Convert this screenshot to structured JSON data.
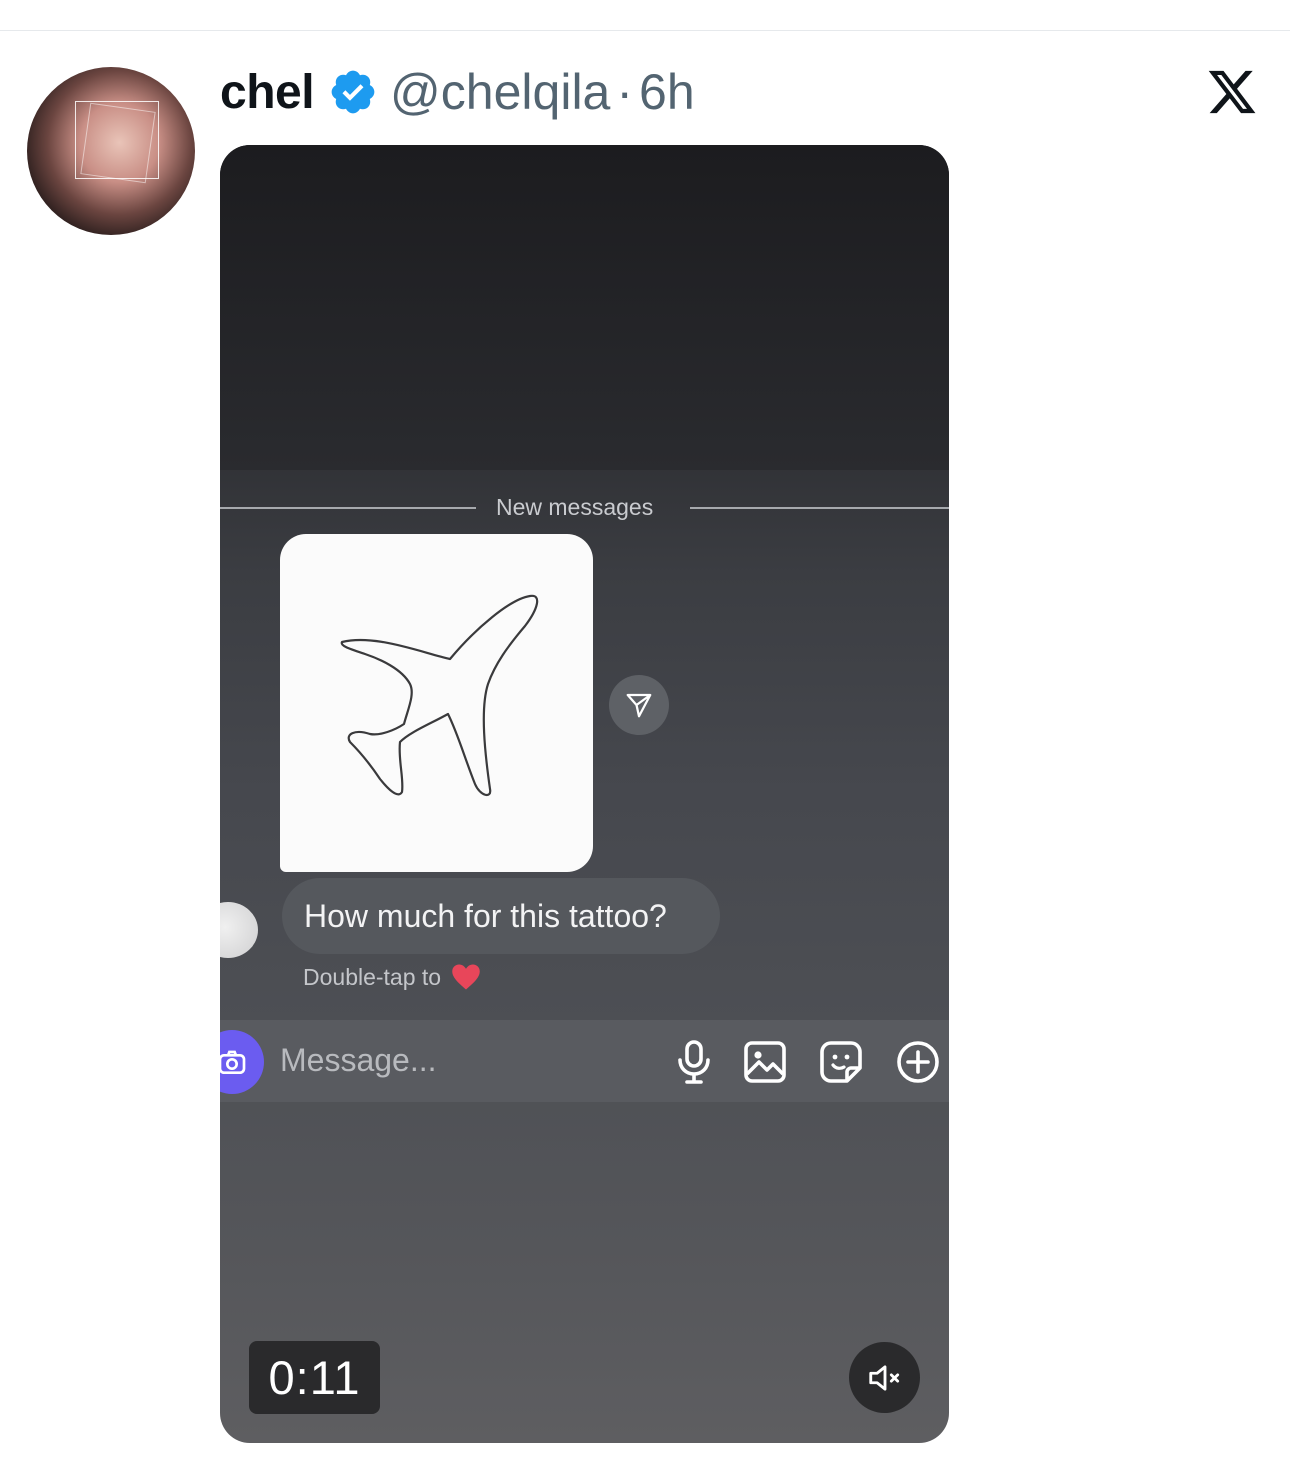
{
  "post": {
    "display_name": "chel",
    "handle": "@chelqila",
    "separator": "·",
    "time": "6h"
  },
  "icons": {
    "verified": "verified-badge-icon",
    "platform": "x-logo-icon",
    "share": "send-icon",
    "camera": "camera-icon",
    "mic": "microphone-icon",
    "gallery": "image-icon",
    "sticker": "sticker-icon",
    "add": "plus-circle-icon",
    "mute": "muted-speaker-icon",
    "heart": "heart-icon"
  },
  "video": {
    "divider_label": "New messages",
    "message_text": "How much for this tattoo?",
    "double_tap_label": "Double-tap to",
    "composer_placeholder": "Message...",
    "duration": "0:11"
  },
  "colors": {
    "verified_blue": "#1d9bf0",
    "camera_purple": "#6b5cf0",
    "heart_red": "#e8465a",
    "muted_text": "#536471"
  }
}
